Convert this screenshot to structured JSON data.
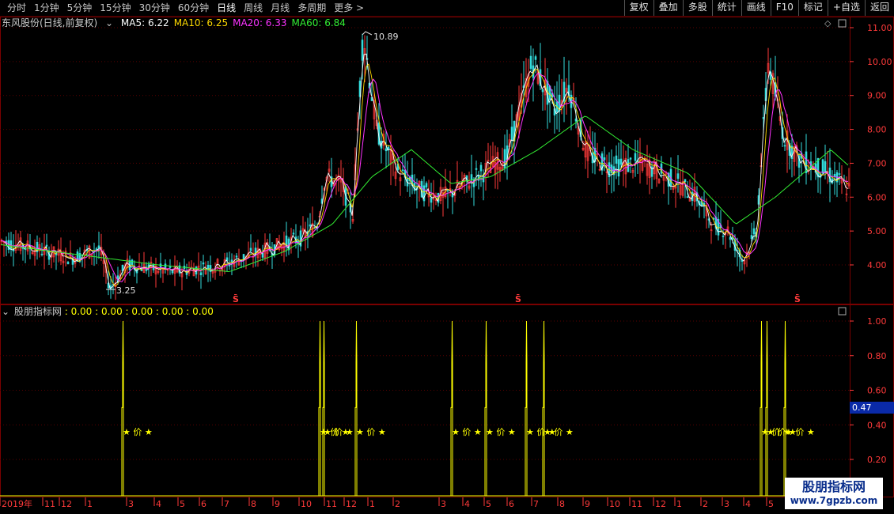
{
  "toolbar": {
    "periods": [
      "分时",
      "1分钟",
      "5分钟",
      "15分钟",
      "30分钟",
      "60分钟",
      "日线",
      "周线",
      "月线",
      "多周期",
      "更多 >"
    ],
    "active_period": "日线",
    "actions": [
      "复权",
      "叠加",
      "多股",
      "统计",
      "画线",
      "F10",
      "标记",
      "+自选",
      "返回"
    ]
  },
  "main_chart": {
    "title": "东风股份(日线,前复权)",
    "ma": [
      {
        "label": "MA5: 6.22",
        "color": "#ffffff"
      },
      {
        "label": "MA10: 6.25",
        "color": "#ffd800"
      },
      {
        "label": "MA20: 6.33",
        "color": "#ff33ff"
      },
      {
        "label": "MA60: 6.84",
        "color": "#33ee33"
      }
    ],
    "high_label": "10.89",
    "low_label": "3.25",
    "s_marker": "S̄",
    "y_ticks": [
      "11.00",
      "10.00",
      "9.00",
      "8.00",
      "7.00",
      "6.00",
      "5.00",
      "4.00"
    ]
  },
  "indicator": {
    "title": "股朋指标网",
    "values_text": ": 0.00 : 0.00 : 0.00 : 0.00 : 0.00",
    "y_ticks": [
      "1.00",
      "0.80",
      "0.60",
      "0.40",
      "0.20"
    ],
    "current_value": "0.47",
    "signal_label": "★ 价 ★"
  },
  "x_axis": {
    "labels": [
      "2019年",
      "11",
      "12",
      "1",
      "3",
      "4",
      "5",
      "6",
      "7",
      "8",
      "9",
      "10",
      "11",
      "12",
      "1",
      "2",
      "3",
      "4",
      "5",
      "6",
      "7",
      "8",
      "9",
      "10",
      "11",
      "12",
      "1",
      "2",
      "3",
      "4",
      "5"
    ]
  },
  "watermark": {
    "line1": "股朋指标网",
    "line2": "www.7gpzb.com"
  },
  "colors": {
    "ma5": "#ffffff",
    "ma10": "#ffd800",
    "ma20": "#ff33ff",
    "ma60": "#33ee33",
    "axis": "#ff3a3a",
    "indicator": "#ffff00",
    "border": "#7a0000"
  },
  "chart_data": {
    "type": "line",
    "title": "东风股份(日线,前复权)",
    "ylim": [
      3.5,
      11.2
    ],
    "price_keypoints": [
      {
        "x": 0,
        "y": 4.7
      },
      {
        "x": 40,
        "y": 4.5
      },
      {
        "x": 90,
        "y": 4.2
      },
      {
        "x": 125,
        "y": 4.5
      },
      {
        "x": 138,
        "y": 3.3
      },
      {
        "x": 160,
        "y": 4.0
      },
      {
        "x": 220,
        "y": 3.8
      },
      {
        "x": 280,
        "y": 4.0
      },
      {
        "x": 330,
        "y": 4.4
      },
      {
        "x": 380,
        "y": 4.8
      },
      {
        "x": 400,
        "y": 5.2
      },
      {
        "x": 410,
        "y": 6.6
      },
      {
        "x": 430,
        "y": 6.4
      },
      {
        "x": 445,
        "y": 5.5
      },
      {
        "x": 458,
        "y": 10.9
      },
      {
        "x": 475,
        "y": 8.0
      },
      {
        "x": 500,
        "y": 6.8
      },
      {
        "x": 530,
        "y": 6.2
      },
      {
        "x": 560,
        "y": 6.0
      },
      {
        "x": 600,
        "y": 6.6
      },
      {
        "x": 640,
        "y": 7.2
      },
      {
        "x": 672,
        "y": 10.0
      },
      {
        "x": 700,
        "y": 8.6
      },
      {
        "x": 718,
        "y": 9.3
      },
      {
        "x": 740,
        "y": 7.3
      },
      {
        "x": 770,
        "y": 6.9
      },
      {
        "x": 810,
        "y": 7.0
      },
      {
        "x": 850,
        "y": 6.5
      },
      {
        "x": 880,
        "y": 6.0
      },
      {
        "x": 900,
        "y": 5.2
      },
      {
        "x": 920,
        "y": 5.0
      },
      {
        "x": 938,
        "y": 4.1
      },
      {
        "x": 955,
        "y": 5.0
      },
      {
        "x": 970,
        "y": 10.0
      },
      {
        "x": 990,
        "y": 7.8
      },
      {
        "x": 1010,
        "y": 7.1
      },
      {
        "x": 1040,
        "y": 6.8
      },
      {
        "x": 1074,
        "y": 6.2
      }
    ],
    "ma60_keypoints": [
      {
        "x": 0,
        "y": 4.6
      },
      {
        "x": 100,
        "y": 4.3
      },
      {
        "x": 200,
        "y": 4.0
      },
      {
        "x": 290,
        "y": 3.8
      },
      {
        "x": 360,
        "y": 4.4
      },
      {
        "x": 420,
        "y": 5.2
      },
      {
        "x": 470,
        "y": 6.6
      },
      {
        "x": 520,
        "y": 7.4
      },
      {
        "x": 570,
        "y": 6.4
      },
      {
        "x": 620,
        "y": 6.6
      },
      {
        "x": 680,
        "y": 7.4
      },
      {
        "x": 740,
        "y": 8.4
      },
      {
        "x": 800,
        "y": 7.4
      },
      {
        "x": 870,
        "y": 6.7
      },
      {
        "x": 930,
        "y": 5.2
      },
      {
        "x": 980,
        "y": 6.0
      },
      {
        "x": 1020,
        "y": 6.8
      },
      {
        "x": 1050,
        "y": 7.4
      },
      {
        "x": 1074,
        "y": 6.9
      }
    ],
    "indicator_spikes": [
      154,
      403,
      408,
      449,
      570,
      613,
      664,
      686,
      961,
      968,
      991
    ]
  }
}
